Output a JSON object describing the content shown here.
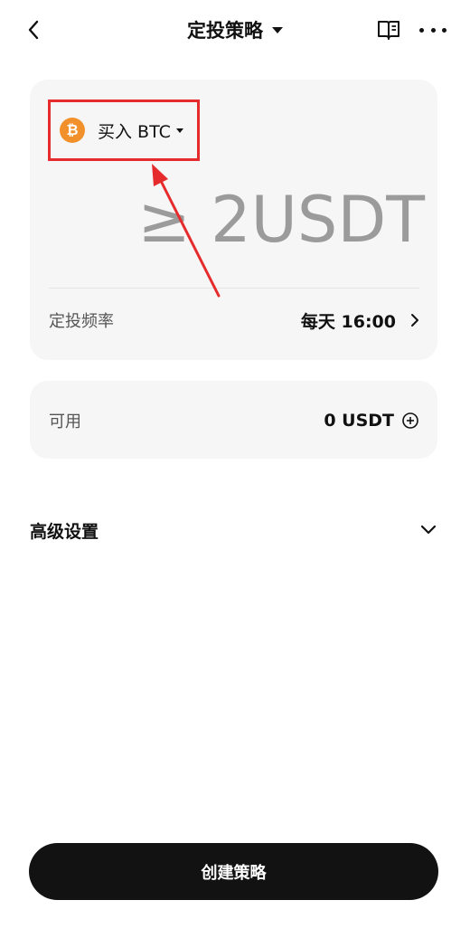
{
  "header": {
    "title": "定投策略",
    "back_icon": "chevron-left-icon",
    "guide_icon": "book-icon",
    "more_icon": "more-horizontal-icon"
  },
  "order": {
    "asset_label": "买入 BTC",
    "asset_icon": "bitcoin-icon",
    "amount_placeholder": "≥ 2USDT",
    "frequency_label": "定投频率",
    "frequency_value": "每天 16:00"
  },
  "balance": {
    "label": "可用",
    "value": "0 USDT",
    "add_icon": "plus-circle-icon"
  },
  "advanced": {
    "label": "高级设置",
    "expand_icon": "chevron-down-icon"
  },
  "footer": {
    "create_label": "创建策略"
  },
  "colors": {
    "accent_btc": "#f2912b",
    "highlight": "#e52b2b",
    "card_bg": "#f6f6f6",
    "button_bg": "#121212"
  }
}
